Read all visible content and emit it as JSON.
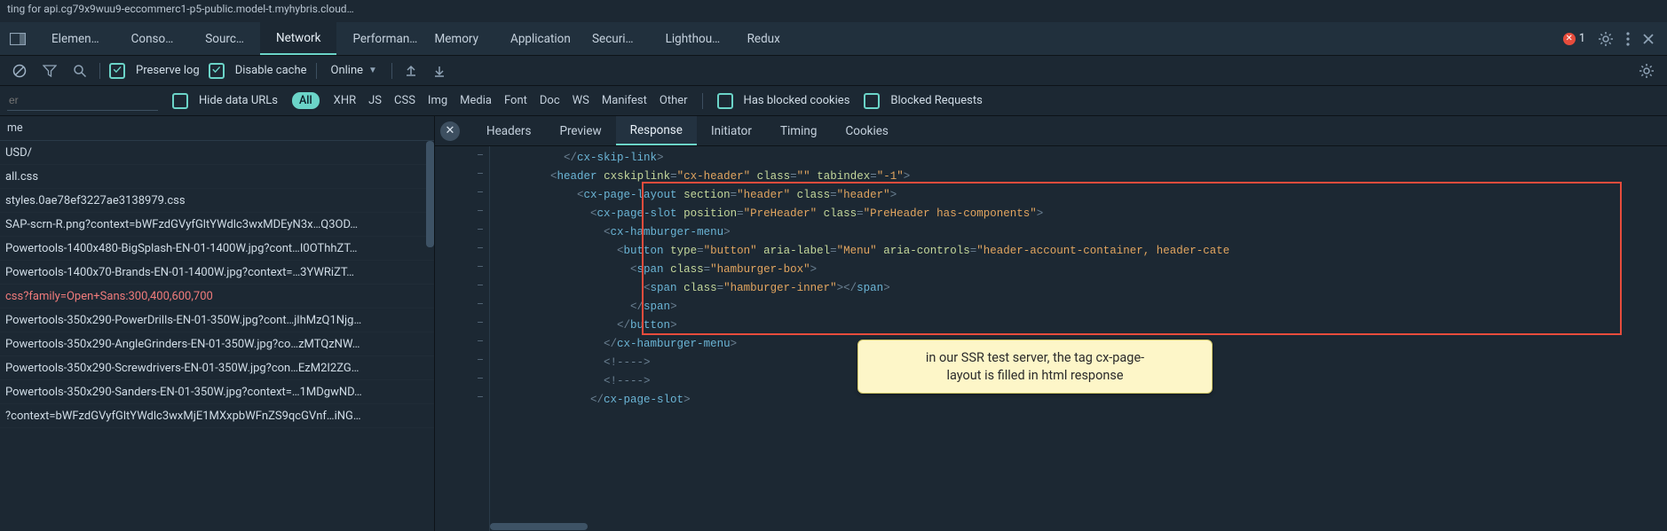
{
  "titlebar": {
    "text": "ting for api.cg79x9wuu9-eccommerc1-p5-public.model-t.myhybris.cloud…"
  },
  "tabs": {
    "items": [
      "Elemen…",
      "Conso…",
      "Sourc…",
      "Network",
      "Performan…",
      "Memory",
      "Application",
      "Securi…",
      "Lighthou…",
      "Redux"
    ],
    "active_index": 3,
    "error_count": "1"
  },
  "toolbar": {
    "preserve_log": "Preserve log",
    "disable_cache": "Disable cache",
    "throttle": "Online"
  },
  "filterbar": {
    "placeholder": "er",
    "hide_data_urls": "Hide data URLs",
    "all": "All",
    "types": [
      "XHR",
      "JS",
      "CSS",
      "Img",
      "Media",
      "Font",
      "Doc",
      "WS",
      "Manifest",
      "Other"
    ],
    "has_blocked": "Has blocked cookies",
    "blocked_req": "Blocked Requests"
  },
  "requests": {
    "col_header": "me",
    "rows": [
      {
        "name": "USD/",
        "red": false
      },
      {
        "name": "all.css",
        "red": false
      },
      {
        "name": "styles.0ae78ef3227ae3138979.css",
        "red": false
      },
      {
        "name": "SAP-scrn-R.png?context=bWFzdGVyfGltYWdlc3wxMDEyN3x…Q3OD…",
        "red": false
      },
      {
        "name": "Powertools-1400x480-BigSplash-EN-01-1400W.jpg?cont…I0OThhZT…",
        "red": false
      },
      {
        "name": "Powertools-1400x70-Brands-EN-01-1400W.jpg?context=…3YWRiZT…",
        "red": false
      },
      {
        "name": "css?family=Open+Sans:300,400,600,700",
        "red": true
      },
      {
        "name": "Powertools-350x290-PowerDrills-EN-01-350W.jpg?cont…jlhMzQ1Njg…",
        "red": false
      },
      {
        "name": "Powertools-350x290-AngleGrinders-EN-01-350W.jpg?co…zMTQzNW…",
        "red": false
      },
      {
        "name": "Powertools-350x290-Screwdrivers-EN-01-350W.jpg?con…EzM2I2ZG…",
        "red": false
      },
      {
        "name": "Powertools-350x290-Sanders-EN-01-350W.jpg?context=…1MDgwND…",
        "red": false
      },
      {
        "name": "?context=bWFzdGVyfGltYWdlc3wxMjE1MXxpbWFnZS9qcGVnf…iNG…",
        "red": false
      }
    ]
  },
  "detail": {
    "tabs": [
      "Headers",
      "Preview",
      "Response",
      "Initiator",
      "Timing",
      "Cookies"
    ],
    "active_index": 2,
    "gutter_lines": [
      "–",
      "–",
      "–",
      "–",
      "–",
      "–",
      "–",
      "–",
      "–",
      "–",
      "–",
      "–",
      "–",
      "–"
    ],
    "code": [
      {
        "indent": 10,
        "tokens": [
          {
            "t": "brkt",
            "v": "</"
          },
          {
            "t": "tag",
            "v": "cx-skip-link"
          },
          {
            "t": "brkt",
            "v": ">"
          }
        ]
      },
      {
        "indent": 8,
        "tokens": [
          {
            "t": "brkt",
            "v": "<"
          },
          {
            "t": "tag",
            "v": "header"
          },
          {
            "t": "plain",
            "v": " "
          },
          {
            "t": "attr",
            "v": "cxskiplink"
          },
          {
            "t": "brkt",
            "v": "="
          },
          {
            "t": "str",
            "v": "\"cx-header\""
          },
          {
            "t": "plain",
            "v": " "
          },
          {
            "t": "attr",
            "v": "class"
          },
          {
            "t": "brkt",
            "v": "="
          },
          {
            "t": "str",
            "v": "\"\""
          },
          {
            "t": "plain",
            "v": " "
          },
          {
            "t": "attr",
            "v": "tabindex"
          },
          {
            "t": "brkt",
            "v": "="
          },
          {
            "t": "str",
            "v": "\"-1\""
          },
          {
            "t": "brkt",
            "v": ">"
          }
        ]
      },
      {
        "indent": 12,
        "tokens": [
          {
            "t": "brkt",
            "v": "<"
          },
          {
            "t": "tag",
            "v": "cx-page-layout"
          },
          {
            "t": "plain",
            "v": " "
          },
          {
            "t": "attr",
            "v": "section"
          },
          {
            "t": "brkt",
            "v": "="
          },
          {
            "t": "str",
            "v": "\"header\""
          },
          {
            "t": "plain",
            "v": " "
          },
          {
            "t": "attr",
            "v": "class"
          },
          {
            "t": "brkt",
            "v": "="
          },
          {
            "t": "str",
            "v": "\"header\""
          },
          {
            "t": "brkt",
            "v": ">"
          }
        ]
      },
      {
        "indent": 14,
        "tokens": [
          {
            "t": "brkt",
            "v": "<"
          },
          {
            "t": "tag",
            "v": "cx-page-slot"
          },
          {
            "t": "plain",
            "v": " "
          },
          {
            "t": "attr",
            "v": "position"
          },
          {
            "t": "brkt",
            "v": "="
          },
          {
            "t": "str",
            "v": "\"PreHeader\""
          },
          {
            "t": "plain",
            "v": " "
          },
          {
            "t": "attr",
            "v": "class"
          },
          {
            "t": "brkt",
            "v": "="
          },
          {
            "t": "str",
            "v": "\"PreHeader has-components\""
          },
          {
            "t": "brkt",
            "v": ">"
          }
        ]
      },
      {
        "indent": 16,
        "tokens": [
          {
            "t": "brkt",
            "v": "<"
          },
          {
            "t": "tag",
            "v": "cx-hamburger-menu"
          },
          {
            "t": "brkt",
            "v": ">"
          }
        ]
      },
      {
        "indent": 18,
        "tokens": [
          {
            "t": "brkt",
            "v": "<"
          },
          {
            "t": "tag",
            "v": "button"
          },
          {
            "t": "plain",
            "v": " "
          },
          {
            "t": "attr",
            "v": "type"
          },
          {
            "t": "brkt",
            "v": "="
          },
          {
            "t": "str",
            "v": "\"button\""
          },
          {
            "t": "plain",
            "v": " "
          },
          {
            "t": "attr",
            "v": "aria-label"
          },
          {
            "t": "brkt",
            "v": "="
          },
          {
            "t": "str",
            "v": "\"Menu\""
          },
          {
            "t": "plain",
            "v": " "
          },
          {
            "t": "attr",
            "v": "aria-controls"
          },
          {
            "t": "brkt",
            "v": "="
          },
          {
            "t": "str",
            "v": "\"header-account-container, header-cate"
          }
        ]
      },
      {
        "indent": 20,
        "tokens": [
          {
            "t": "brkt",
            "v": "<"
          },
          {
            "t": "tag",
            "v": "span"
          },
          {
            "t": "plain",
            "v": " "
          },
          {
            "t": "attr",
            "v": "class"
          },
          {
            "t": "brkt",
            "v": "="
          },
          {
            "t": "str",
            "v": "\"hamburger-box\""
          },
          {
            "t": "brkt",
            "v": ">"
          }
        ]
      },
      {
        "indent": 22,
        "tokens": [
          {
            "t": "brkt",
            "v": "<"
          },
          {
            "t": "tag",
            "v": "span"
          },
          {
            "t": "plain",
            "v": " "
          },
          {
            "t": "attr",
            "v": "class"
          },
          {
            "t": "brkt",
            "v": "="
          },
          {
            "t": "str",
            "v": "\"hamburger-inner\""
          },
          {
            "t": "brkt",
            "v": ">"
          },
          {
            "t": "brkt",
            "v": "</"
          },
          {
            "t": "tag",
            "v": "span"
          },
          {
            "t": "brkt",
            "v": ">"
          }
        ]
      },
      {
        "indent": 20,
        "tokens": [
          {
            "t": "brkt",
            "v": "</"
          },
          {
            "t": "tag",
            "v": "span"
          },
          {
            "t": "brkt",
            "v": ">"
          }
        ]
      },
      {
        "indent": 18,
        "tokens": [
          {
            "t": "brkt",
            "v": "</"
          },
          {
            "t": "tag",
            "v": "button"
          },
          {
            "t": "brkt",
            "v": ">"
          }
        ]
      },
      {
        "indent": 16,
        "tokens": [
          {
            "t": "brkt",
            "v": "</"
          },
          {
            "t": "tag",
            "v": "cx-hamburger-menu"
          },
          {
            "t": "brkt",
            "v": ">"
          }
        ]
      },
      {
        "indent": 16,
        "tokens": [
          {
            "t": "cmt",
            "v": "<!---->"
          }
        ]
      },
      {
        "indent": 16,
        "tokens": [
          {
            "t": "cmt",
            "v": "<!---->"
          }
        ]
      },
      {
        "indent": 14,
        "tokens": [
          {
            "t": "brkt",
            "v": "</"
          },
          {
            "t": "tag",
            "v": "cx-page-slot"
          },
          {
            "t": "brkt",
            "v": ">"
          }
        ]
      }
    ]
  },
  "annotation": {
    "line1": "in our SSR test server, the tag cx-page-",
    "line2": "layout is filled in html response"
  }
}
